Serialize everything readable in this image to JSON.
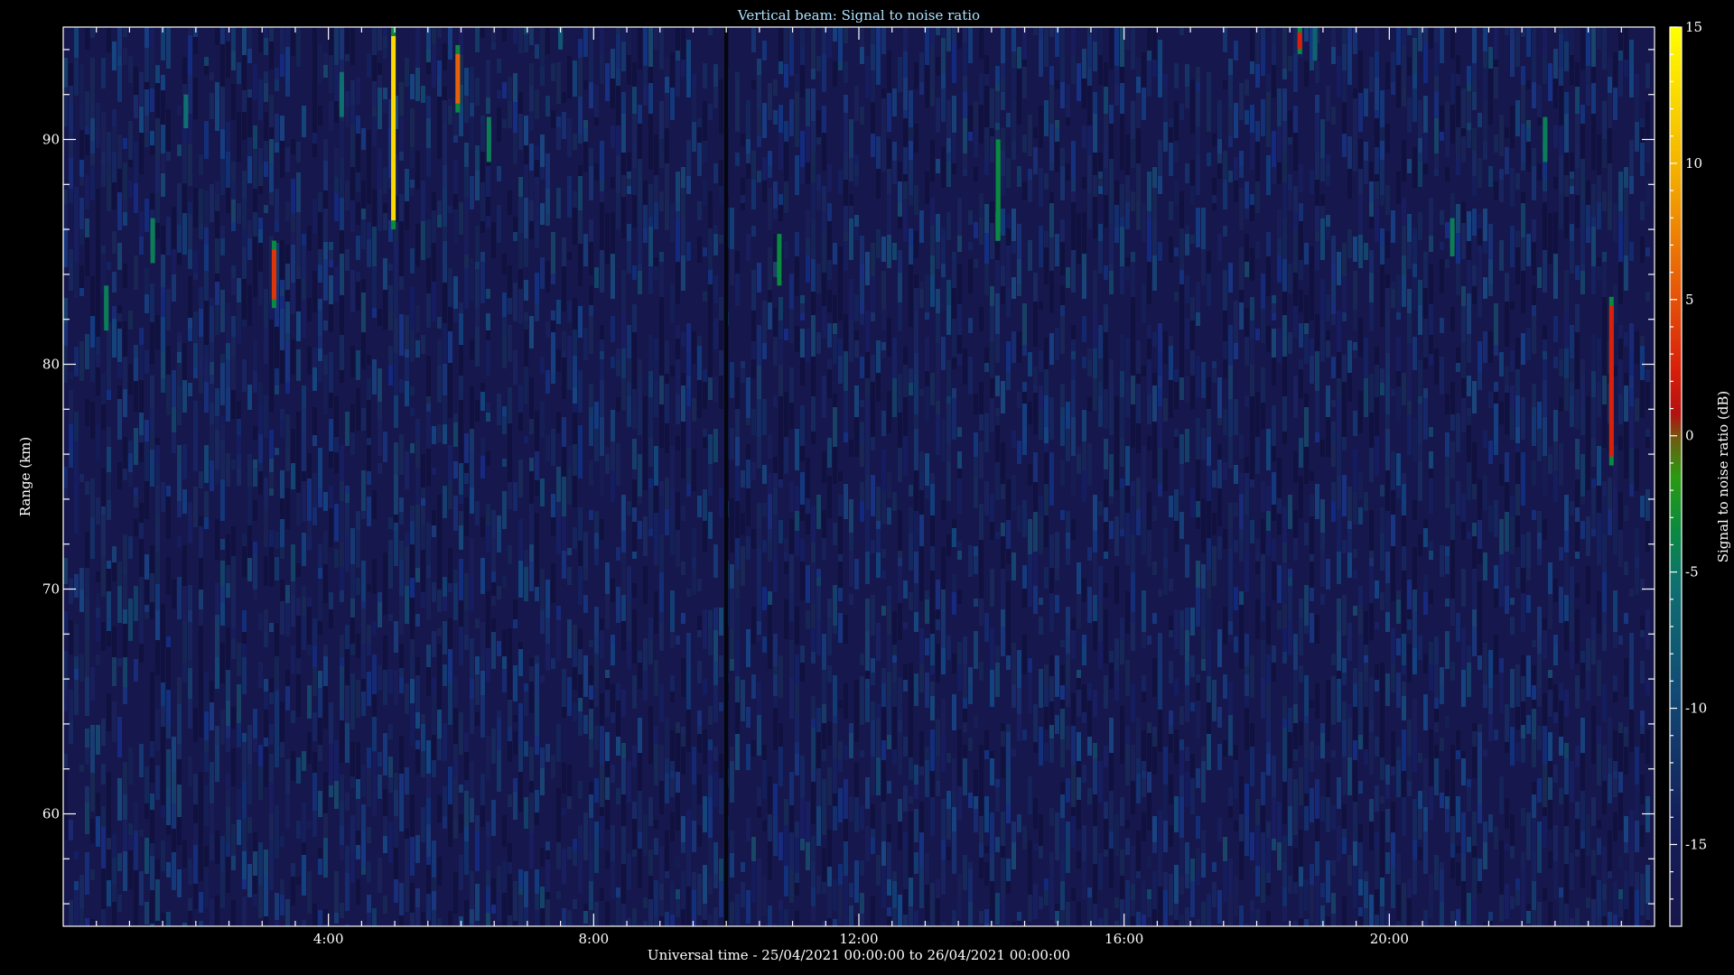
{
  "chart_data": {
    "type": "heatmap",
    "title": "Vertical beam: Signal to noise ratio",
    "xlabel": "Universal time - 25/04/2021 00:00:00 to 26/04/2021 00:00:00",
    "ylabel": "Range (km)",
    "x_range_hours": [
      0,
      24
    ],
    "x_ticks": [
      {
        "hour": 4,
        "label": "4:00"
      },
      {
        "hour": 8,
        "label": "8:00"
      },
      {
        "hour": 12,
        "label": "12:00"
      },
      {
        "hour": 16,
        "label": "16:00"
      },
      {
        "hour": 20,
        "label": "20:00"
      }
    ],
    "ylim": [
      55,
      95
    ],
    "y_ticks": [
      {
        "value": 60,
        "label": "60"
      },
      {
        "value": 70,
        "label": "70"
      },
      {
        "value": 80,
        "label": "80"
      },
      {
        "value": 90,
        "label": "90"
      }
    ],
    "colorbar": {
      "label": "Signal to noise ratio (dB)",
      "range": [
        -18,
        15
      ],
      "ticks": [
        {
          "value": 15,
          "label": "15"
        },
        {
          "value": 10,
          "label": "10"
        },
        {
          "value": 5,
          "label": "5"
        },
        {
          "value": 0,
          "label": "0"
        },
        {
          "value": -5,
          "label": "-5"
        },
        {
          "value": -10,
          "label": "-10"
        },
        {
          "value": -15,
          "label": "-15"
        }
      ],
      "colors": [
        "#14144e",
        "#123c6e",
        "#0f6a7a",
        "#0a8a4a",
        "#1a9a10",
        "#c8130a",
        "#e25808",
        "#f0a600",
        "#ffff00"
      ]
    },
    "background_snr_db": -16,
    "data_gap_hours": [
      9.97,
      10.03
    ],
    "echoes": [
      {
        "time_h": 0.65,
        "range_km": [
          81.5,
          83.5
        ],
        "snr_db": -6
      },
      {
        "time_h": 1.35,
        "range_km": [
          84.5,
          86.5
        ],
        "snr_db": -6
      },
      {
        "time_h": 1.85,
        "range_km": [
          90.5,
          92
        ],
        "snr_db": -7
      },
      {
        "time_h": 3.18,
        "range_km": [
          82.5,
          85.5
        ],
        "snr_db": 3
      },
      {
        "time_h": 4.2,
        "range_km": [
          91,
          93
        ],
        "snr_db": -7
      },
      {
        "time_h": 4.98,
        "range_km": [
          86,
          95
        ],
        "snr_db": 12
      },
      {
        "time_h": 5.95,
        "range_km": [
          91.2,
          94.2
        ],
        "snr_db": 5
      },
      {
        "time_h": 6.42,
        "range_km": [
          89,
          91
        ],
        "snr_db": -6
      },
      {
        "time_h": 7.5,
        "range_km": [
          94,
          95
        ],
        "snr_db": -9
      },
      {
        "time_h": 10.8,
        "range_km": [
          83.5,
          85.8
        ],
        "snr_db": -5
      },
      {
        "time_h": 14.1,
        "range_km": [
          85.5,
          90
        ],
        "snr_db": -5
      },
      {
        "time_h": 18.65,
        "range_km": [
          93.8,
          95
        ],
        "snr_db": 2
      },
      {
        "time_h": 18.88,
        "range_km": [
          93.5,
          95
        ],
        "snr_db": -8
      },
      {
        "time_h": 20.95,
        "range_km": [
          84.8,
          86.5
        ],
        "snr_db": -6
      },
      {
        "time_h": 22.35,
        "range_km": [
          89,
          91
        ],
        "snr_db": -6
      },
      {
        "time_h": 23.35,
        "range_km": [
          75.5,
          83
        ],
        "snr_db": 2
      }
    ]
  }
}
